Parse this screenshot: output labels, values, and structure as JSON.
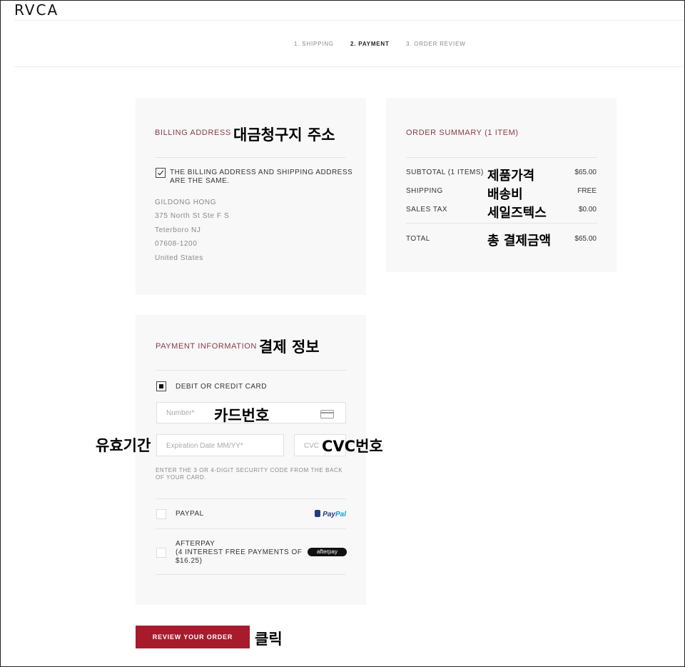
{
  "header": {
    "logo": "RVCA",
    "steps": [
      {
        "label": "1. SHIPPING"
      },
      {
        "label": "2. PAYMENT"
      },
      {
        "label": "3. ORDER REVIEW"
      }
    ]
  },
  "billing": {
    "title": "BILLING ADDRESS",
    "annotation": "대금청구지 주소",
    "same_as_shipping_line1": "THE BILLING ADDRESS AND SHIPPING ADDRESS",
    "same_as_shipping_line2": "ARE THE SAME.",
    "address": {
      "name": "GILDONG HONG",
      "street": "375 North St Ste F S",
      "city": "Teterboro NJ",
      "zip": "07608-1200",
      "country": "United States"
    }
  },
  "summary": {
    "title": "ORDER SUMMARY (1 ITEM)",
    "rows": [
      {
        "label": "SUBTOTAL (1 ITEMS)",
        "annotation": "제품가격",
        "value": "$65.00"
      },
      {
        "label": "SHIPPING",
        "annotation": "배송비",
        "value": "FREE"
      },
      {
        "label": "SALES TAX",
        "annotation": "세일즈텍스",
        "value": "$0.00"
      }
    ],
    "total": {
      "label": "TOTAL",
      "annotation": "총 결제금액",
      "value": "$65.00"
    }
  },
  "payment": {
    "title": "PAYMENT INFORMATION",
    "annotation": "결제 정보",
    "card_option": "DEBIT OR CREDIT CARD",
    "number_placeholder": "Number*",
    "number_annotation": "카드번호",
    "expiry_placeholder": "Expiration Date MM/YY*",
    "expiry_annotation": "유효기간",
    "cvc_placeholder": "CVC",
    "cvc_annotation": "CVC번호",
    "hint_line1": "ENTER THE 3 OR 4-DIGIT SECURITY CODE FROM THE BACK",
    "hint_line2": "OF YOUR CARD.",
    "paypal_option": "PAYPAL",
    "paypal_logo_a": "Pay",
    "paypal_logo_b": "Pal",
    "afterpay_line1": "AFTERPAY",
    "afterpay_line2": "(4 INTEREST FREE PAYMENTS OF",
    "afterpay_line3": "$16.25)",
    "afterpay_logo": "afterpay"
  },
  "actions": {
    "review_label": "REVIEW YOUR ORDER",
    "review_annotation": "클릭"
  },
  "colors": {
    "accent": "#a71b2c",
    "section_title": "#8a3a44",
    "panel_bg": "#f8f8f8"
  }
}
